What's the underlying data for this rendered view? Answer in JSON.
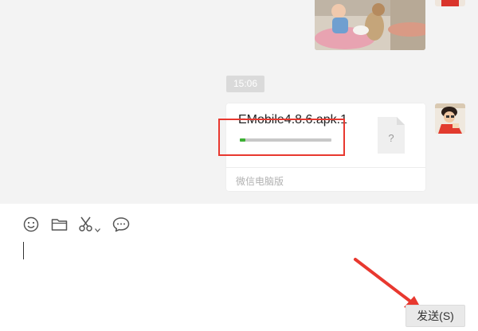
{
  "chat": {
    "time_badge": "15:06",
    "file_message": {
      "file_name": "EMobile4.8.6.apk.1",
      "progress_fraction": 0.06,
      "source_label": "微信电脑版",
      "file_icon_glyph": "?"
    }
  },
  "toolbar": {
    "icons": [
      "emoji-icon",
      "folder-icon",
      "scissors-icon",
      "chevron-down-icon",
      "chat-bubble-icon"
    ]
  },
  "composer": {
    "send_label": "发送(S)"
  },
  "colors": {
    "highlight_box": "#e8382f",
    "progress_green": "#3cb034",
    "chat_background": "#f3f3f3"
  }
}
